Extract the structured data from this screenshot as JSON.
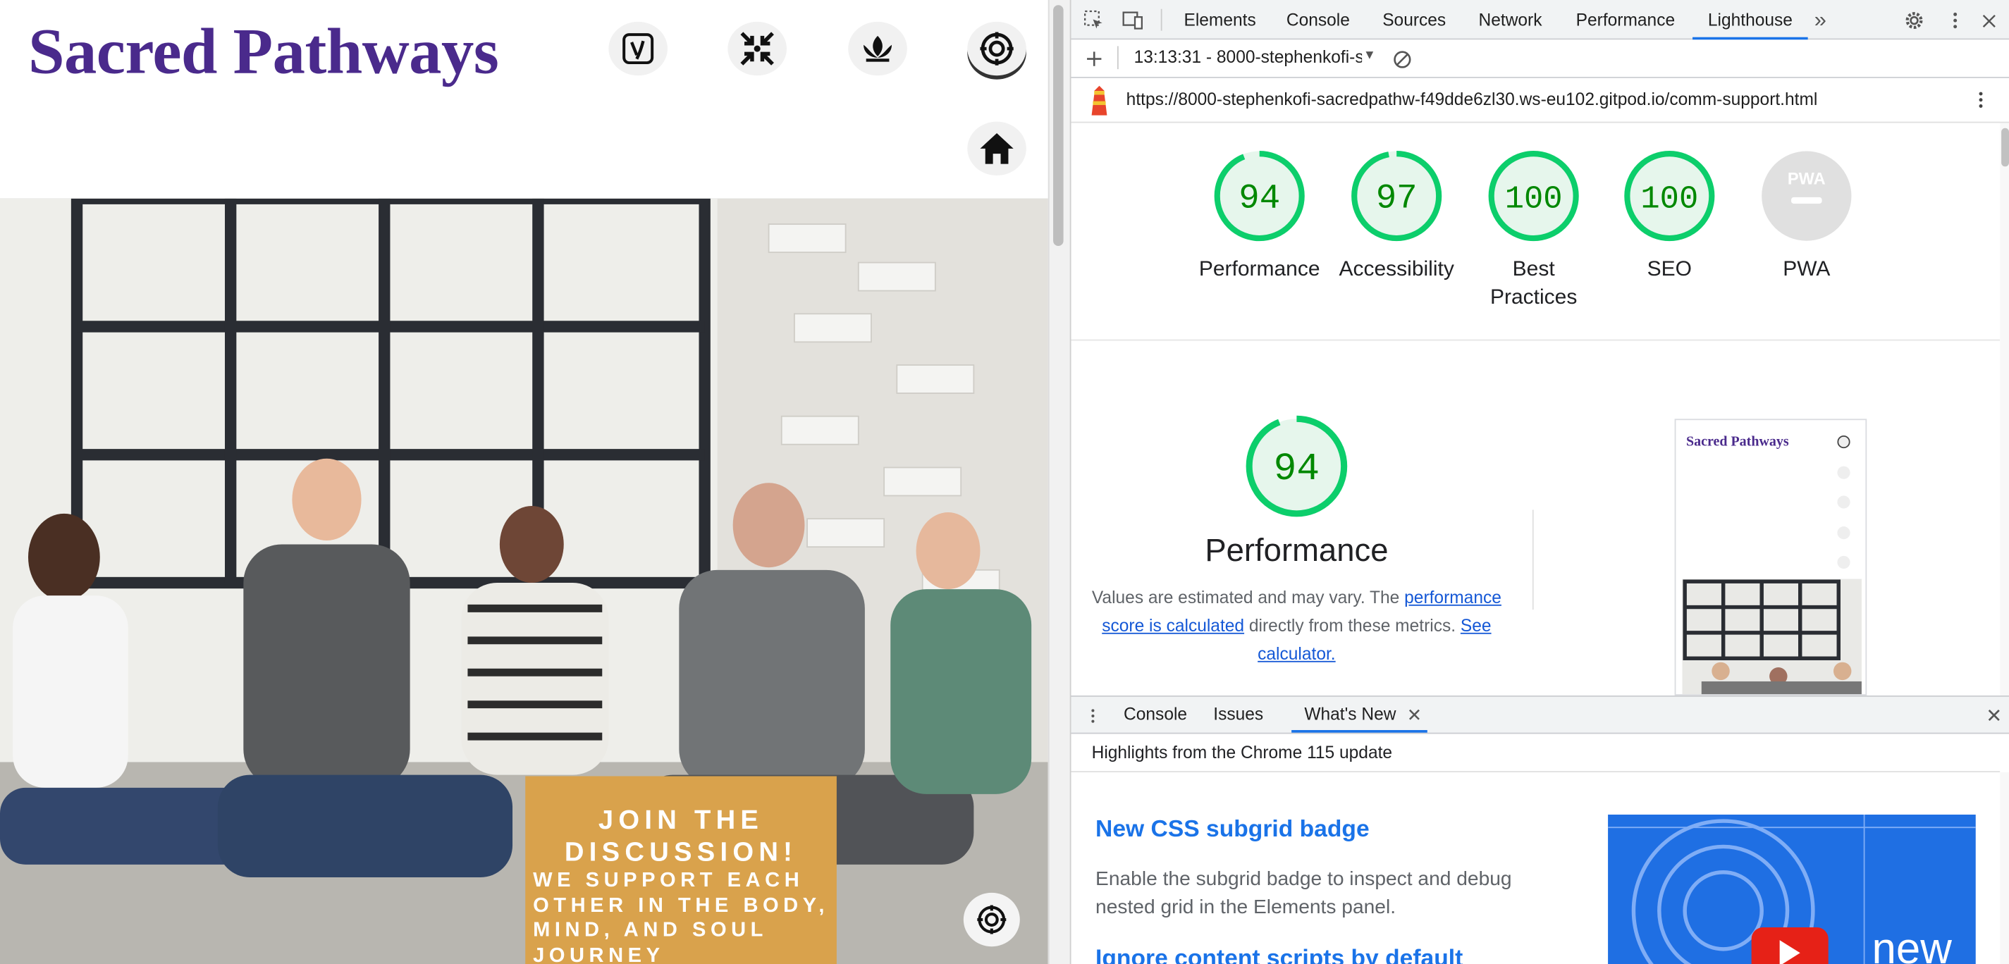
{
  "site": {
    "title": "Sacred Pathways",
    "nav_icons": [
      "yoga-logo-icon",
      "compress-icon",
      "lotus-icon",
      "chakra-icon",
      "home-icon"
    ],
    "hero_cta": {
      "title": "JOIN THE DISCUSSION!",
      "body": "WE SUPPORT EACH OTHER IN THE BODY, MIND, AND SOUL JOURNEY"
    },
    "colors": {
      "title": "#4a2a8c",
      "cta_bg": "#d9a24c"
    }
  },
  "devtools": {
    "tabs": [
      "Elements",
      "Console",
      "Sources",
      "Network",
      "Performance",
      "Lighthouse"
    ],
    "active_tab": "Lighthouse",
    "more_tabs": "»",
    "report_selector": "13:13:31 - 8000-stephenkofi-s",
    "url": "https://8000-stephenkofi-sacredpathw-f49dde6zl30.ws-eu102.gitpod.io/comm-support.html",
    "scores": [
      {
        "label": "Performance",
        "score": "94"
      },
      {
        "label": "Accessibility",
        "score": "97"
      },
      {
        "label": "Best Practices",
        "score": "100"
      },
      {
        "label": "SEO",
        "score": "100"
      },
      {
        "label": "PWA",
        "score": ""
      }
    ],
    "pwa_badge": "PWA",
    "perf_section": {
      "score": "94",
      "title": "Performance",
      "desc_prefix": "Values are estimated and may vary. The ",
      "link1": "performance score is calculated",
      "desc_mid": " directly from these metrics. ",
      "link2": "See calculator."
    },
    "thumbnail_title": "Sacred Pathways",
    "drawer_tabs": [
      "Console",
      "Issues",
      "What's New"
    ],
    "drawer_active": "What's New",
    "whats_new": {
      "highlight": "Highlights from the Chrome 115 update",
      "item1_title": "New CSS subgrid badge",
      "item1_body": "Enable the subgrid badge to inspect and debug nested grid in the Elements panel.",
      "item2_title": "Ignore content scripts by default",
      "video_word": "new"
    },
    "colors": {
      "accent": "#1a73e8",
      "gauge_good": "#0cce6b",
      "score_text": "#008800"
    }
  }
}
